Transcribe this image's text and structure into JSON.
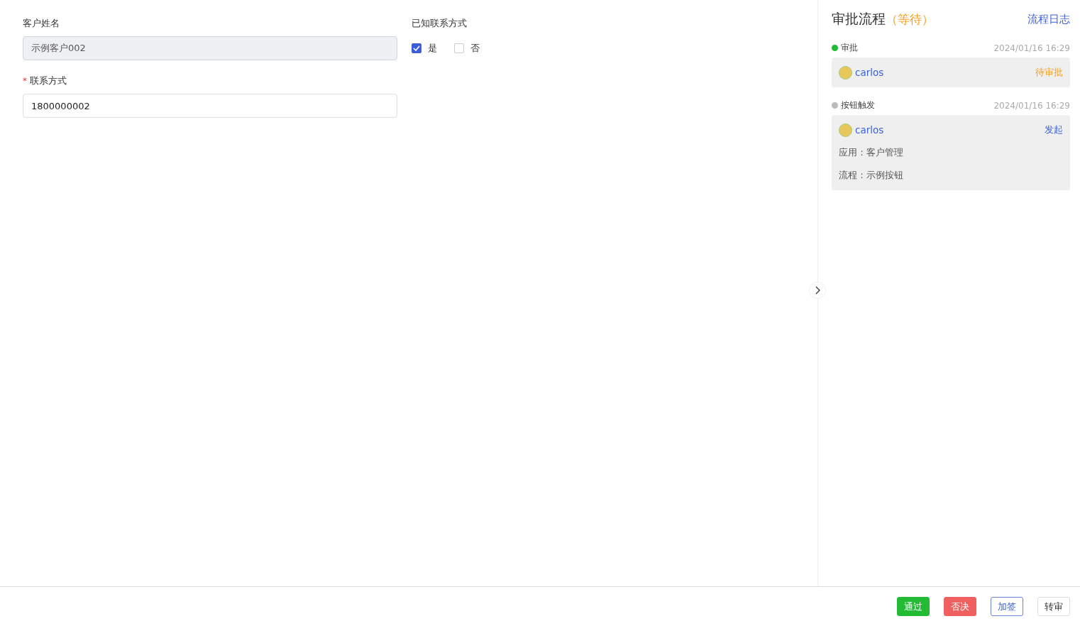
{
  "form": {
    "fields": [
      {
        "kind": "text",
        "label": "客户姓名",
        "disabled": true,
        "value": "示例客户002"
      },
      {
        "kind": "checkbox_group",
        "label": "已知联系方式",
        "options": [
          {
            "label": "是",
            "checked": true
          },
          {
            "label": "否",
            "checked": false
          }
        ]
      },
      {
        "kind": "text",
        "required_mark": "*",
        "label": "联系方式",
        "disabled": false,
        "value": "1800000002"
      }
    ]
  },
  "approval_panel": {
    "title": "审批流程",
    "status": "（等待）",
    "log_link": "流程日志",
    "collapsed": false,
    "steps": [
      {
        "name": "审批",
        "color": "#22bb33",
        "time": "2024/01/16 16:29",
        "user": "carlos",
        "state": "待审批",
        "pending": true
      },
      {
        "name": "按钮触发",
        "color": "#bbbbbb",
        "time": "2024/01/16 16:29",
        "user": "carlos",
        "state": "发起",
        "pending": false,
        "details": [
          {
            "label": "应用：",
            "value": "客户管理"
          },
          {
            "label": "流程：",
            "value": "示例按钮"
          }
        ]
      }
    ]
  },
  "actions": [
    {
      "label": "通过",
      "kind": "approve",
      "hovered": false
    },
    {
      "label": "否决",
      "kind": "reject",
      "hovered": false
    },
    {
      "label": "加签",
      "kind": "default",
      "hovered": true
    },
    {
      "label": "转审",
      "kind": "default",
      "hovered": false
    }
  ]
}
